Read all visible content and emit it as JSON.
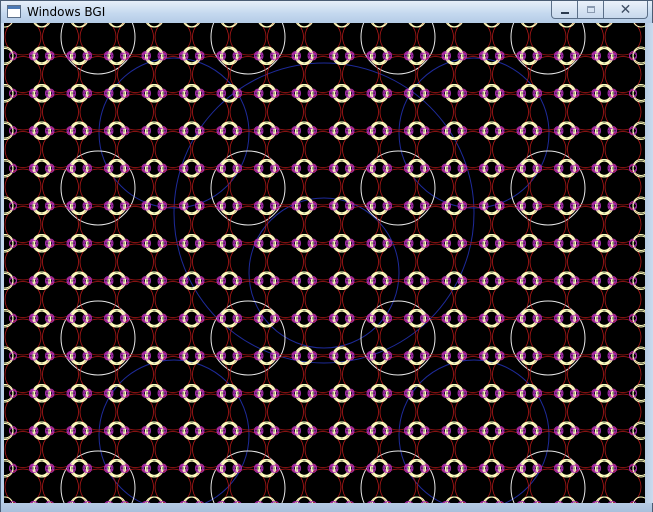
{
  "window": {
    "title": "Windows BGI"
  },
  "titlebar": {
    "icon": "app-window-icon",
    "buttons": {
      "minimize_icon": "minimize-icon",
      "maximize_icon": "maximize-icon",
      "close_label": "✕"
    }
  },
  "canvas": {
    "background": "#000000",
    "pattern": "recursive-circle-fractal",
    "colors": {
      "large_ring": "#1e2a9a",
      "mid_ring": "#e6e6e6",
      "red_ring": "#b01818",
      "small_ring": "#ffffc0",
      "tiny_ring": "#b030b8"
    }
  }
}
